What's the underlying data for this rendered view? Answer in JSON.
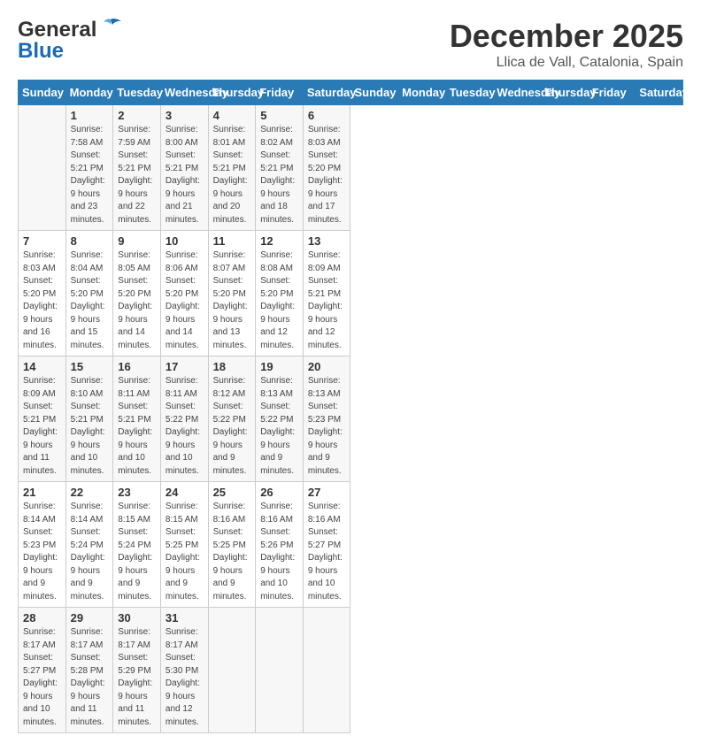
{
  "header": {
    "logo_line1": "General",
    "logo_line2": "Blue",
    "month_title": "December 2025",
    "location": "Llica de Vall, Catalonia, Spain"
  },
  "days_of_week": [
    "Sunday",
    "Monday",
    "Tuesday",
    "Wednesday",
    "Thursday",
    "Friday",
    "Saturday"
  ],
  "weeks": [
    [
      {
        "day": "",
        "info": ""
      },
      {
        "day": "1",
        "info": "Sunrise: 7:58 AM\nSunset: 5:21 PM\nDaylight: 9 hours\nand 23 minutes."
      },
      {
        "day": "2",
        "info": "Sunrise: 7:59 AM\nSunset: 5:21 PM\nDaylight: 9 hours\nand 22 minutes."
      },
      {
        "day": "3",
        "info": "Sunrise: 8:00 AM\nSunset: 5:21 PM\nDaylight: 9 hours\nand 21 minutes."
      },
      {
        "day": "4",
        "info": "Sunrise: 8:01 AM\nSunset: 5:21 PM\nDaylight: 9 hours\nand 20 minutes."
      },
      {
        "day": "5",
        "info": "Sunrise: 8:02 AM\nSunset: 5:21 PM\nDaylight: 9 hours\nand 18 minutes."
      },
      {
        "day": "6",
        "info": "Sunrise: 8:03 AM\nSunset: 5:20 PM\nDaylight: 9 hours\nand 17 minutes."
      }
    ],
    [
      {
        "day": "7",
        "info": "Sunrise: 8:03 AM\nSunset: 5:20 PM\nDaylight: 9 hours\nand 16 minutes."
      },
      {
        "day": "8",
        "info": "Sunrise: 8:04 AM\nSunset: 5:20 PM\nDaylight: 9 hours\nand 15 minutes."
      },
      {
        "day": "9",
        "info": "Sunrise: 8:05 AM\nSunset: 5:20 PM\nDaylight: 9 hours\nand 14 minutes."
      },
      {
        "day": "10",
        "info": "Sunrise: 8:06 AM\nSunset: 5:20 PM\nDaylight: 9 hours\nand 14 minutes."
      },
      {
        "day": "11",
        "info": "Sunrise: 8:07 AM\nSunset: 5:20 PM\nDaylight: 9 hours\nand 13 minutes."
      },
      {
        "day": "12",
        "info": "Sunrise: 8:08 AM\nSunset: 5:20 PM\nDaylight: 9 hours\nand 12 minutes."
      },
      {
        "day": "13",
        "info": "Sunrise: 8:09 AM\nSunset: 5:21 PM\nDaylight: 9 hours\nand 12 minutes."
      }
    ],
    [
      {
        "day": "14",
        "info": "Sunrise: 8:09 AM\nSunset: 5:21 PM\nDaylight: 9 hours\nand 11 minutes."
      },
      {
        "day": "15",
        "info": "Sunrise: 8:10 AM\nSunset: 5:21 PM\nDaylight: 9 hours\nand 10 minutes."
      },
      {
        "day": "16",
        "info": "Sunrise: 8:11 AM\nSunset: 5:21 PM\nDaylight: 9 hours\nand 10 minutes."
      },
      {
        "day": "17",
        "info": "Sunrise: 8:11 AM\nSunset: 5:22 PM\nDaylight: 9 hours\nand 10 minutes."
      },
      {
        "day": "18",
        "info": "Sunrise: 8:12 AM\nSunset: 5:22 PM\nDaylight: 9 hours\nand 9 minutes."
      },
      {
        "day": "19",
        "info": "Sunrise: 8:13 AM\nSunset: 5:22 PM\nDaylight: 9 hours\nand 9 minutes."
      },
      {
        "day": "20",
        "info": "Sunrise: 8:13 AM\nSunset: 5:23 PM\nDaylight: 9 hours\nand 9 minutes."
      }
    ],
    [
      {
        "day": "21",
        "info": "Sunrise: 8:14 AM\nSunset: 5:23 PM\nDaylight: 9 hours\nand 9 minutes."
      },
      {
        "day": "22",
        "info": "Sunrise: 8:14 AM\nSunset: 5:24 PM\nDaylight: 9 hours\nand 9 minutes."
      },
      {
        "day": "23",
        "info": "Sunrise: 8:15 AM\nSunset: 5:24 PM\nDaylight: 9 hours\nand 9 minutes."
      },
      {
        "day": "24",
        "info": "Sunrise: 8:15 AM\nSunset: 5:25 PM\nDaylight: 9 hours\nand 9 minutes."
      },
      {
        "day": "25",
        "info": "Sunrise: 8:16 AM\nSunset: 5:25 PM\nDaylight: 9 hours\nand 9 minutes."
      },
      {
        "day": "26",
        "info": "Sunrise: 8:16 AM\nSunset: 5:26 PM\nDaylight: 9 hours\nand 10 minutes."
      },
      {
        "day": "27",
        "info": "Sunrise: 8:16 AM\nSunset: 5:27 PM\nDaylight: 9 hours\nand 10 minutes."
      }
    ],
    [
      {
        "day": "28",
        "info": "Sunrise: 8:17 AM\nSunset: 5:27 PM\nDaylight: 9 hours\nand 10 minutes."
      },
      {
        "day": "29",
        "info": "Sunrise: 8:17 AM\nSunset: 5:28 PM\nDaylight: 9 hours\nand 11 minutes."
      },
      {
        "day": "30",
        "info": "Sunrise: 8:17 AM\nSunset: 5:29 PM\nDaylight: 9 hours\nand 11 minutes."
      },
      {
        "day": "31",
        "info": "Sunrise: 8:17 AM\nSunset: 5:30 PM\nDaylight: 9 hours\nand 12 minutes."
      },
      {
        "day": "",
        "info": ""
      },
      {
        "day": "",
        "info": ""
      },
      {
        "day": "",
        "info": ""
      }
    ]
  ]
}
